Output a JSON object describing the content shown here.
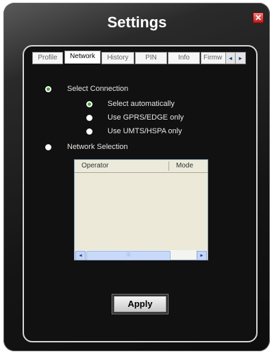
{
  "window": {
    "title": "Settings",
    "close_icon": "close-icon"
  },
  "tabs": [
    {
      "label": "Profile",
      "active": false
    },
    {
      "label": "Network",
      "active": true
    },
    {
      "label": "History",
      "active": false
    },
    {
      "label": "PIN",
      "active": false
    },
    {
      "label": "Info",
      "active": false
    },
    {
      "label": "Firmw",
      "active": false
    }
  ],
  "tab_nav": {
    "prev": "◂",
    "next": "▸"
  },
  "network": {
    "select_connection": {
      "label": "Select Connection",
      "selected": true
    },
    "options": [
      {
        "label": "Select automatically",
        "selected": true
      },
      {
        "label": "Use GPRS/EDGE only",
        "selected": false
      },
      {
        "label": "Use UMTS/HSPA only",
        "selected": false
      }
    ],
    "network_selection": {
      "label": "Network Selection",
      "selected": false
    }
  },
  "operator_list": {
    "columns": [
      "Operator",
      "Mode"
    ],
    "rows": [],
    "scroll_left": "◂",
    "scroll_right": "▸",
    "thumb_grip": "⁞⁞⁞"
  },
  "apply_label": "Apply",
  "colors": {
    "accent_radio": "#44a832",
    "list_bg": "#ece9d8"
  }
}
